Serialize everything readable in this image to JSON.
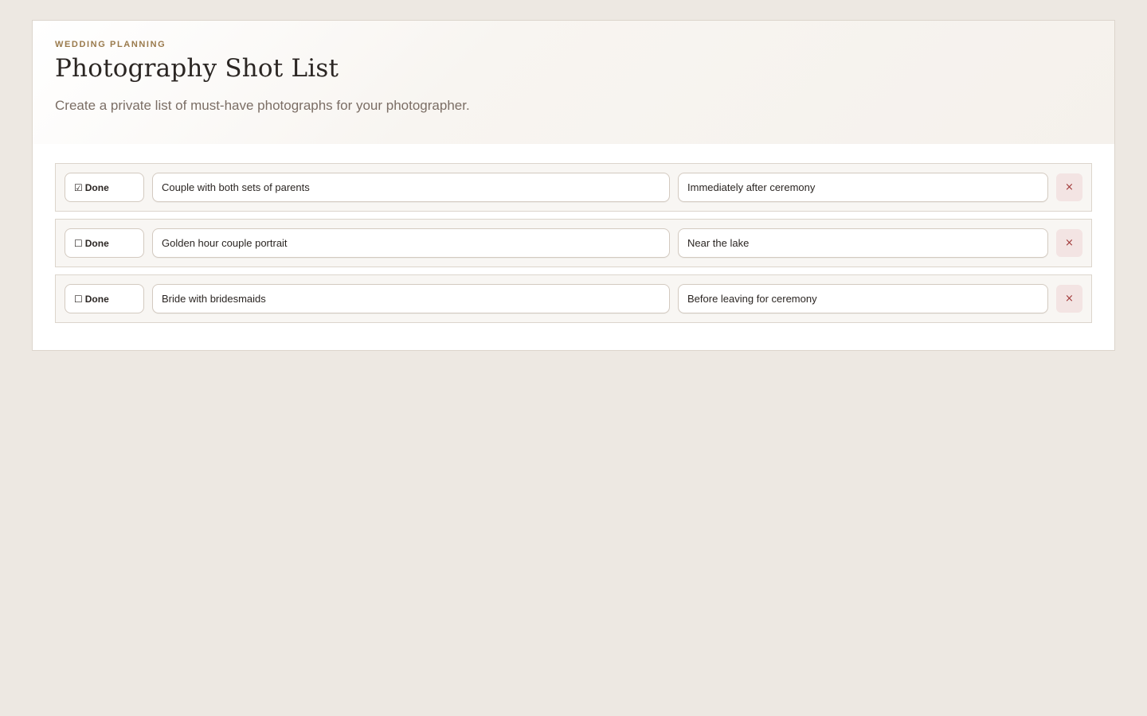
{
  "header": {
    "eyebrow": "WEDDING PLANNING",
    "title": "Photography Shot List",
    "subtitle": "Create a private list of must-have photographs for your photographer."
  },
  "shots": [
    {
      "done": true,
      "checkbox_glyph": "☑",
      "done_label": "Done",
      "shot": "Couple with both sets of parents",
      "note": "Immediately after ceremony",
      "remove_glyph": "×"
    },
    {
      "done": false,
      "checkbox_glyph": "☐",
      "done_label": "Done",
      "shot": "Golden hour couple portrait",
      "note": "Near the lake",
      "remove_glyph": "×"
    },
    {
      "done": false,
      "checkbox_glyph": "☐",
      "done_label": "Done",
      "shot": "Bride with bridesmaids",
      "note": "Before leaving for ceremony",
      "remove_glyph": "×"
    }
  ],
  "colors": {
    "page_background": "#ede8e2",
    "accent": "#9a7a4c",
    "remove_background": "#f3e4e3",
    "remove_text": "#a13a3a"
  }
}
